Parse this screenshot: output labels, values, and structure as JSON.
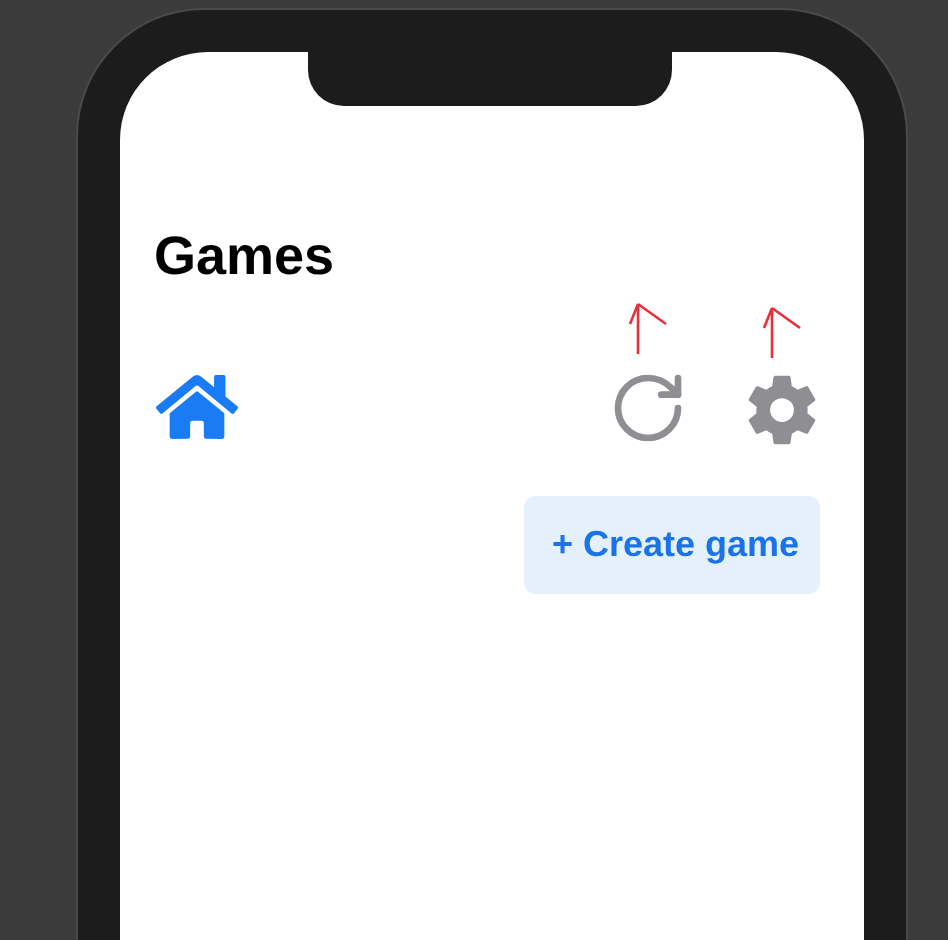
{
  "screen": {
    "title": "Games"
  },
  "actions": [
    {
      "label": "+ Create game"
    }
  ]
}
